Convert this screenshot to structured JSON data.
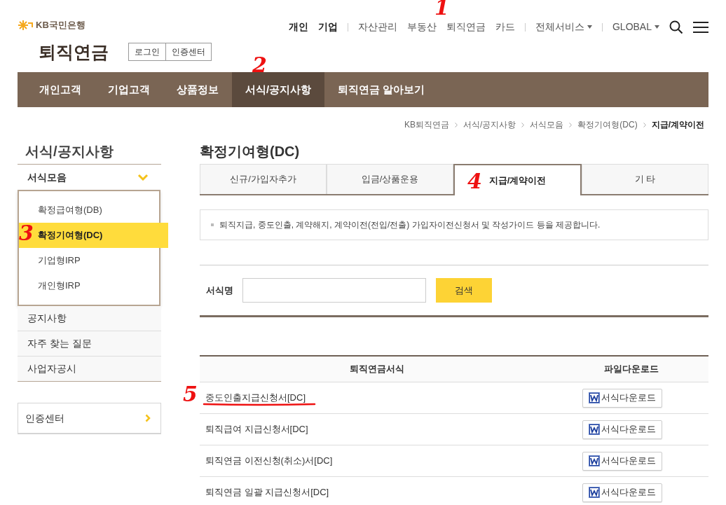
{
  "header": {
    "logo": "KB국민은행",
    "top_nav": [
      {
        "label": "개인",
        "bold": true
      },
      {
        "label": "기업",
        "bold": true
      },
      {
        "label": "자산관리",
        "bold": false
      },
      {
        "label": "부동산",
        "bold": false
      },
      {
        "label": "퇴직연금",
        "bold": false
      },
      {
        "label": "카드",
        "bold": false
      }
    ],
    "all_services": "전체서비스",
    "global": "GLOBAL",
    "site_title": "퇴직연금",
    "auth_buttons": [
      "로그인",
      "인증센터"
    ]
  },
  "main_nav": [
    {
      "label": "개인고객",
      "selected": false
    },
    {
      "label": "기업고객",
      "selected": false
    },
    {
      "label": "상품정보",
      "selected": false
    },
    {
      "label": "서식/공지사항",
      "selected": true
    },
    {
      "label": "퇴직연금 알아보기",
      "selected": false
    }
  ],
  "breadcrumb": [
    "KB퇴직연금",
    "서식/공지사항",
    "서식모음",
    "확정기여형(DC)",
    "지급/계약이전"
  ],
  "sidebar": {
    "title": "서식/공지사항",
    "menu": [
      {
        "label": "서식모음",
        "expanded": true,
        "children": [
          {
            "label": "확정급여형(DB)",
            "selected": false
          },
          {
            "label": "확정기여형(DC)",
            "selected": true
          },
          {
            "label": "기업형IRP",
            "selected": false
          },
          {
            "label": "개인형IRP",
            "selected": false
          }
        ]
      },
      {
        "label": "공지사항"
      },
      {
        "label": "자주 찾는 질문"
      },
      {
        "label": "사업자공시"
      }
    ],
    "cert_link": "인증센터"
  },
  "page_title": "확정기여형(DC)",
  "tabs": [
    {
      "label": "신규/가입자추가",
      "selected": false
    },
    {
      "label": "입금/상품운용",
      "selected": false
    },
    {
      "label": "지급/계약이전",
      "selected": true
    },
    {
      "label": "기 타",
      "selected": false
    }
  ],
  "description": "퇴직지급, 중도인출, 계약해지, 계약이전(전입/전출) 가입자이전신청서 및 작성가이드 등을 제공합니다.",
  "search": {
    "label": "서식명",
    "button": "검색"
  },
  "table": {
    "columns": [
      "퇴직연금서식",
      "파일다운로드"
    ],
    "rows": [
      {
        "name": "중도인출지급신청서[DC]",
        "download": "서식다운로드"
      },
      {
        "name": "퇴직급여 지급신청서[DC]",
        "download": "서식다운로드"
      },
      {
        "name": "퇴직연금 이전신청(취소)서[DC]",
        "download": "서식다운로드"
      },
      {
        "name": "퇴직연금 일괄 지급신청서[DC]",
        "download": "서식다운로드"
      }
    ]
  },
  "annotations": [
    {
      "text": "1"
    },
    {
      "text": "2"
    },
    {
      "text": "3"
    },
    {
      "text": "4"
    },
    {
      "text": "5"
    }
  ]
}
